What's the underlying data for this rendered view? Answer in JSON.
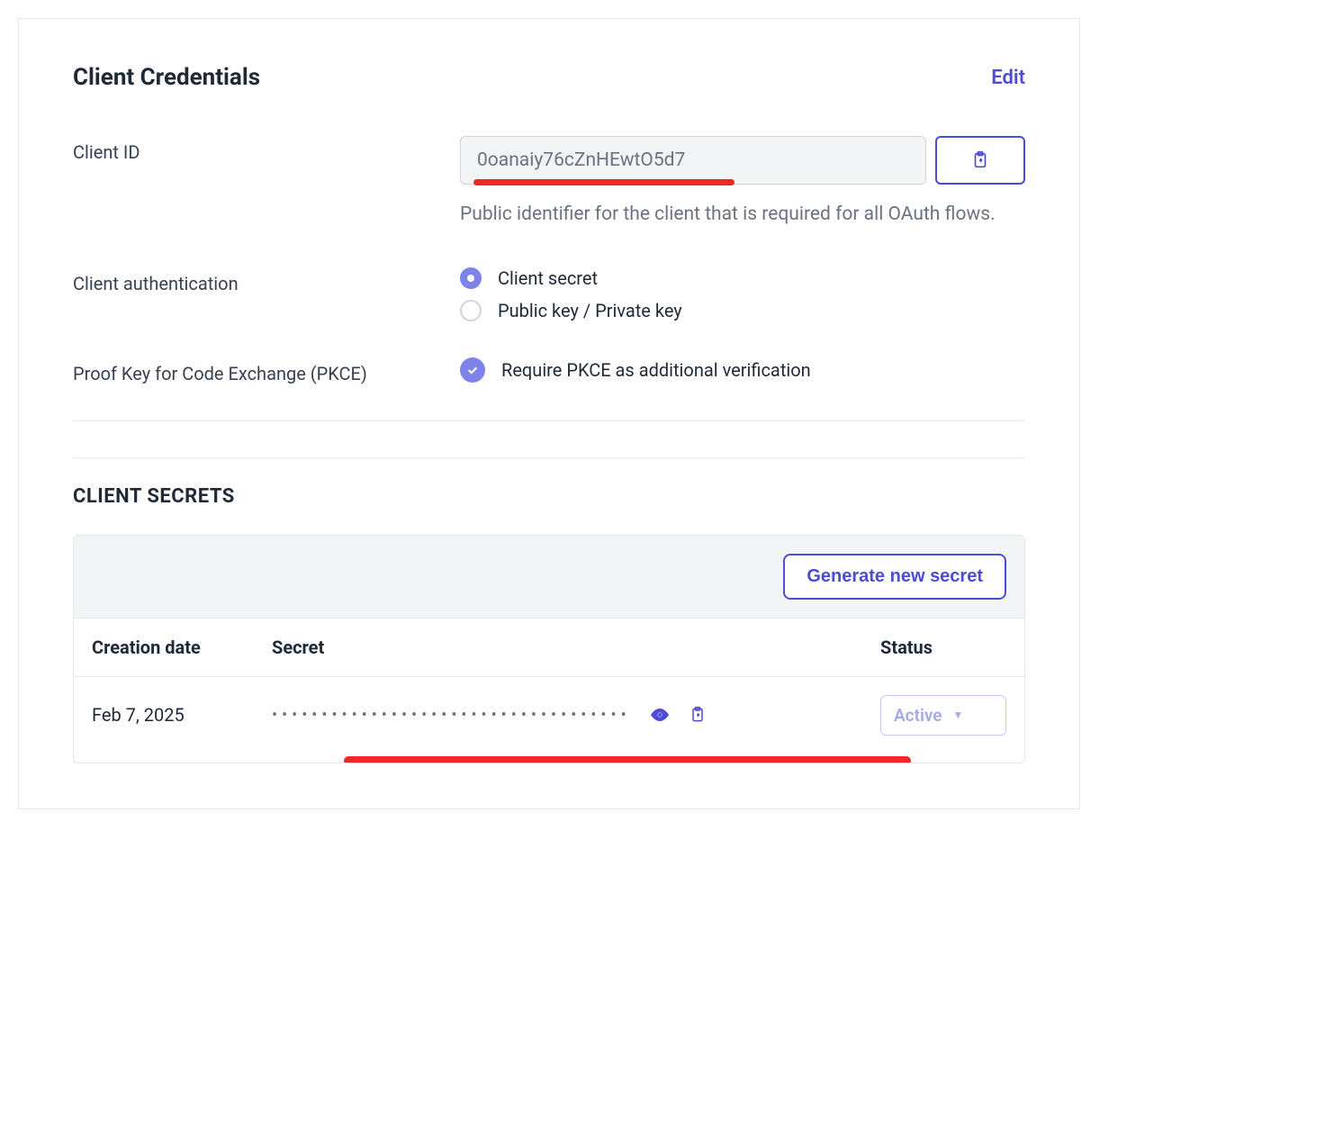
{
  "section": {
    "title": "Client Credentials",
    "edit_label": "Edit"
  },
  "client_id": {
    "label": "Client ID",
    "value": "0oanaiy76cZnHEwtO5d7",
    "help": "Public identifier for the client that is required for all OAuth flows."
  },
  "client_auth": {
    "label": "Client authentication",
    "option_secret": "Client secret",
    "option_keypair": "Public key / Private key"
  },
  "pkce": {
    "label": "Proof Key for Code Exchange (PKCE)",
    "checkbox_label": "Require PKCE as additional verification"
  },
  "secrets": {
    "title": "CLIENT SECRETS",
    "generate_button": "Generate new secret",
    "columns": {
      "date": "Creation date",
      "secret": "Secret",
      "status": "Status"
    },
    "rows": [
      {
        "date": "Feb 7, 2025",
        "masked": "••••••••••••••••••••••••••••••••••••",
        "status": "Active"
      }
    ]
  }
}
